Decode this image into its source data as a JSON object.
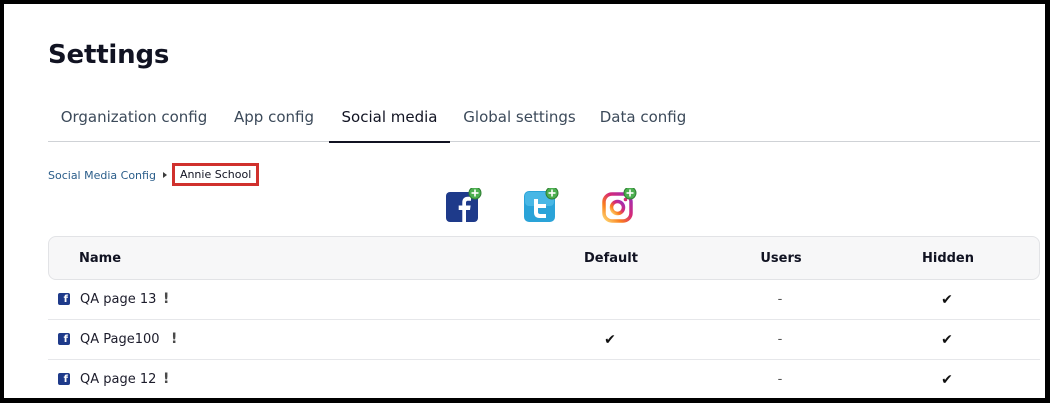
{
  "page": {
    "title": "Settings"
  },
  "tabs": [
    {
      "label": "Organization config",
      "active": false
    },
    {
      "label": "App config",
      "active": false
    },
    {
      "label": "Social media",
      "active": true
    },
    {
      "label": "Global settings",
      "active": false
    },
    {
      "label": "Data config",
      "active": false
    }
  ],
  "breadcrumb": {
    "parent": "Social Media Config",
    "current": "Annie School"
  },
  "social_buttons": [
    {
      "icon": "facebook-add-icon",
      "color": "#1e3a8a"
    },
    {
      "icon": "twitter-add-icon",
      "color": "#2aa3d8"
    },
    {
      "icon": "instagram-add-icon",
      "color": "#e1306c"
    }
  ],
  "table": {
    "headers": {
      "name": "Name",
      "default": "Default",
      "users": "Users",
      "hidden": "Hidden"
    },
    "rows": [
      {
        "name": "QA page 13",
        "warning": "!",
        "default": "",
        "users": "-",
        "hidden": "✔"
      },
      {
        "name": "QA Page100",
        "warning": "!",
        "default": "✔",
        "users": "-",
        "hidden": "✔"
      },
      {
        "name": "QA page 12",
        "warning": "!",
        "default": "",
        "users": "-",
        "hidden": "✔"
      }
    ]
  },
  "colors": {
    "accent_text": "#111322",
    "link": "#2a5d8a",
    "highlight_border": "#d0312d",
    "plus_badge": "#4caf50"
  }
}
